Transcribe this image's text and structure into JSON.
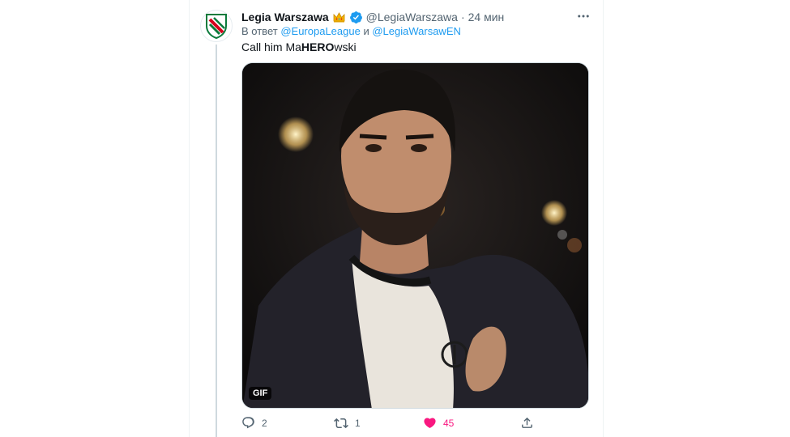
{
  "tweet": {
    "author_name": "Legia Warszawa",
    "author_handle": "@LegiaWarszawa",
    "separator": "·",
    "timestamp": "24 мин",
    "reply_prefix": "В ответ",
    "reply_user_1": "@EuropaLeague",
    "reply_joiner": "и",
    "reply_user_2": "@LegiaWarsawEN",
    "text_before": "Call him Ma",
    "text_bold": "HERO",
    "text_after": "wski",
    "media_badge": "GIF"
  },
  "actions": {
    "reply_count": "2",
    "retweet_count": "1",
    "like_count": "45"
  },
  "colors": {
    "link": "#1d9bf0",
    "like": "#f91880",
    "muted": "#536471",
    "verified": "#1d9bf0",
    "crown": "#f5b400",
    "logo_green": "#0b7a3b",
    "logo_red": "#d6001c"
  },
  "icons": {
    "more": "more-horizontal-icon",
    "reply": "speech-bubble-icon",
    "retweet": "retweet-icon",
    "like": "heart-icon",
    "share": "share-upload-icon",
    "verified": "verified-badge-icon",
    "crown": "crown-emoji-icon"
  }
}
